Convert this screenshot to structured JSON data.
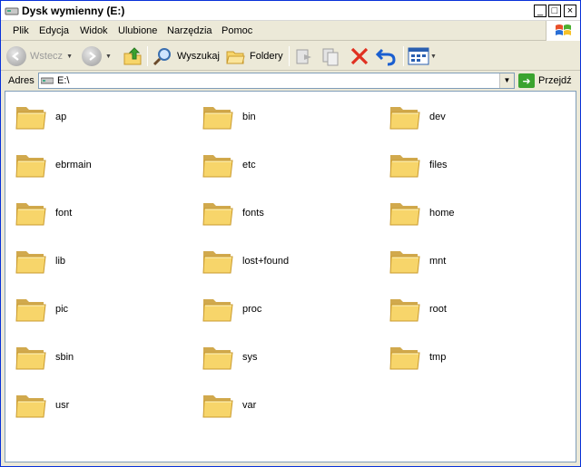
{
  "window": {
    "title": "Dysk wymienny (E:)",
    "controls": {
      "minimize": "_",
      "maximize": "□",
      "close": "×"
    }
  },
  "menu": {
    "items": [
      "Plik",
      "Edycja",
      "Widok",
      "Ulubione",
      "Narzędzia",
      "Pomoc"
    ]
  },
  "toolbar": {
    "back_label": "Wstecz",
    "search_label": "Wyszukaj",
    "folders_label": "Foldery"
  },
  "address": {
    "label": "Adres",
    "value": "E:\\",
    "go_label": "Przejdź"
  },
  "colors": {
    "folder_fill": "#f7d56a",
    "folder_edge": "#c99a2e",
    "title_text": "#000000",
    "go_green": "#3aa32f",
    "delete_red": "#e03020",
    "undo_blue": "#1a5fd0"
  },
  "folders": [
    "ap",
    "bin",
    "dev",
    "ebrmain",
    "etc",
    "files",
    "font",
    "fonts",
    "home",
    "lib",
    "lost+found",
    "mnt",
    "pic",
    "proc",
    "root",
    "sbin",
    "sys",
    "tmp",
    "usr",
    "var"
  ]
}
